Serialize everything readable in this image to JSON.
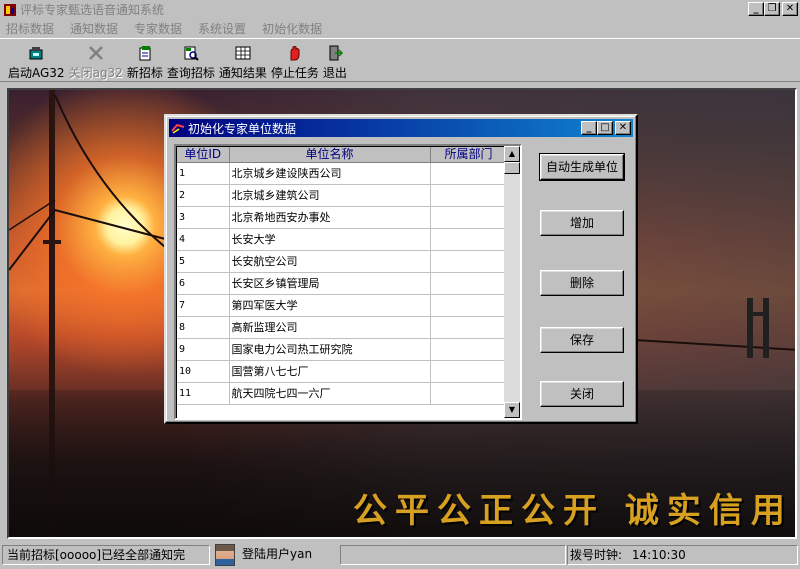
{
  "window": {
    "title": "评标专家甄选语音通知系统"
  },
  "menu": [
    "招标数据",
    "通知数据",
    "专家数据",
    "系统设置",
    "初始化数据"
  ],
  "toolbar": [
    {
      "label": "启动AG32",
      "icon": "phone-start-icon",
      "disabled": false
    },
    {
      "label": "关闭ag32",
      "icon": "close-x-icon",
      "disabled": true
    },
    {
      "label": "新招标",
      "icon": "new-bid-icon",
      "disabled": false
    },
    {
      "label": "查询招标",
      "icon": "query-bid-icon",
      "disabled": false
    },
    {
      "label": "通知结果",
      "icon": "notify-result-icon",
      "disabled": false
    },
    {
      "label": "停止任务",
      "icon": "stop-task-icon",
      "disabled": false
    },
    {
      "label": "退出",
      "icon": "exit-icon",
      "disabled": false
    }
  ],
  "slogan": "公平公正公开  诚实信用",
  "dialog": {
    "title": "初始化专家单位数据",
    "columns": [
      "单位ID",
      "单位名称",
      "所属部门"
    ],
    "rows": [
      {
        "id": "1",
        "name": "北京城乡建设陕西公司",
        "dept": ""
      },
      {
        "id": "2",
        "name": "北京城乡建筑公司",
        "dept": ""
      },
      {
        "id": "3",
        "name": "北京希地西安办事处",
        "dept": ""
      },
      {
        "id": "4",
        "name": "长安大学",
        "dept": ""
      },
      {
        "id": "5",
        "name": "长安航空公司",
        "dept": ""
      },
      {
        "id": "6",
        "name": "长安区乡镇管理局",
        "dept": ""
      },
      {
        "id": "7",
        "name": "第四军医大学",
        "dept": ""
      },
      {
        "id": "8",
        "name": "高新监理公司",
        "dept": ""
      },
      {
        "id": "9",
        "name": "国家电力公司热工研究院",
        "dept": ""
      },
      {
        "id": "10",
        "name": "国营第八七七厂",
        "dept": ""
      },
      {
        "id": "11",
        "name": "航天四院七四一六厂",
        "dept": ""
      }
    ],
    "buttons": {
      "auto_generate": "自动生成单位",
      "add": "增加",
      "delete": "删除",
      "save": "保存",
      "close": "关闭"
    }
  },
  "status": {
    "message": "当前招标[ooooo]已经全部通知完",
    "user": "登陆用户yan",
    "clock_label": "拨号时钟:",
    "clock_time": "14:10:30"
  },
  "colors": {
    "dialog_title": "#000080",
    "slogan": "#d8a020",
    "header_text": "#000080"
  }
}
